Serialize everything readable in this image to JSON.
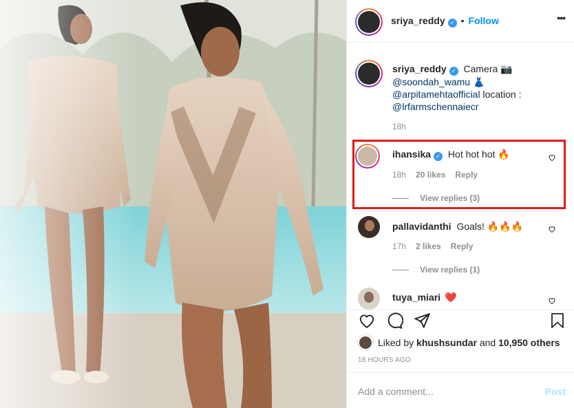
{
  "post": {
    "author": "sriya_reddy",
    "follow_label": "Follow",
    "more_label": "•••"
  },
  "caption": {
    "author": "sriya_reddy",
    "line1": "Camera 📷",
    "line2": "@soondah_wamu 👗",
    "line3_mention": "@arpitamehtaofficial",
    "line3_rest": " location :",
    "line4": "@lrfarmschennaiecr",
    "time": "18h"
  },
  "comments": [
    {
      "user": "ihansika",
      "text": "Hot hot hot 🔥",
      "time": "18h",
      "likes": "20 likes",
      "reply": "Reply",
      "view_replies": "View replies (3)"
    },
    {
      "user": "pallavidanthi",
      "text": "Goals! 🔥🔥🔥",
      "time": "17h",
      "likes": "2 likes",
      "reply": "Reply",
      "view_replies": "View replies (1)"
    },
    {
      "user": "tuya_miari",
      "text": "❤️"
    }
  ],
  "likes": {
    "prefix": "Liked by ",
    "user": "khushsundar",
    "middle": " and ",
    "count": "10,950 others"
  },
  "timestamp": "18 HOURS AGO",
  "add_comment": {
    "placeholder": "Add a comment...",
    "post_label": "Post"
  },
  "colors": {
    "accent": "#0095f6",
    "highlight": "#e01b1b",
    "verified": "#3897f0"
  }
}
